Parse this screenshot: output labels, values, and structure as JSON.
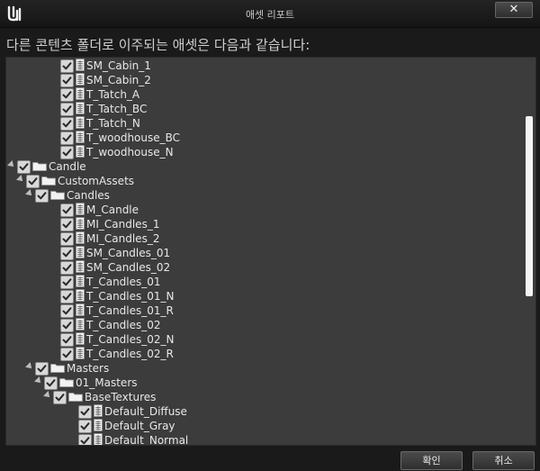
{
  "window": {
    "title": "애셋 리포트",
    "close_label": "✕"
  },
  "heading": "다른 콘텐츠 폴더로 이주되는 애셋은 다음과 같습니다:",
  "tree": [
    {
      "label": "SM_Cabin_1",
      "depth": 3,
      "kind": "file",
      "checked": true
    },
    {
      "label": "SM_Cabin_2",
      "depth": 3,
      "kind": "file",
      "checked": true
    },
    {
      "label": "T_Tatch_A",
      "depth": 3,
      "kind": "file",
      "checked": true
    },
    {
      "label": "T_Tatch_BC",
      "depth": 3,
      "kind": "file",
      "checked": true
    },
    {
      "label": "T_Tatch_N",
      "depth": 3,
      "kind": "file",
      "checked": true
    },
    {
      "label": "T_woodhouse_BC",
      "depth": 3,
      "kind": "file",
      "checked": true
    },
    {
      "label": "T_woodhouse_N",
      "depth": 3,
      "kind": "file",
      "checked": true
    },
    {
      "label": "Candle",
      "depth": 0,
      "kind": "folder",
      "checked": true
    },
    {
      "label": "CustomAssets",
      "depth": 1,
      "kind": "folder",
      "checked": true
    },
    {
      "label": "Candles",
      "depth": 2,
      "kind": "folder",
      "checked": true
    },
    {
      "label": "M_Candle",
      "depth": 3,
      "kind": "file",
      "checked": true
    },
    {
      "label": "MI_Candles_1",
      "depth": 3,
      "kind": "file",
      "checked": true
    },
    {
      "label": "MI_Candles_2",
      "depth": 3,
      "kind": "file",
      "checked": true
    },
    {
      "label": "SM_Candles_01",
      "depth": 3,
      "kind": "file",
      "checked": true
    },
    {
      "label": "SM_Candles_02",
      "depth": 3,
      "kind": "file",
      "checked": true
    },
    {
      "label": "T_Candles_01",
      "depth": 3,
      "kind": "file",
      "checked": true
    },
    {
      "label": "T_Candles_01_N",
      "depth": 3,
      "kind": "file",
      "checked": true
    },
    {
      "label": "T_Candles_01_R",
      "depth": 3,
      "kind": "file",
      "checked": true
    },
    {
      "label": "T_Candles_02",
      "depth": 3,
      "kind": "file",
      "checked": true
    },
    {
      "label": "T_Candles_02_N",
      "depth": 3,
      "kind": "file",
      "checked": true
    },
    {
      "label": "T_Candles_02_R",
      "depth": 3,
      "kind": "file",
      "checked": true
    },
    {
      "label": "Masters",
      "depth": 2,
      "kind": "folder",
      "checked": true
    },
    {
      "label": "01_Masters",
      "depth": 3,
      "kind": "folder",
      "checked": true
    },
    {
      "label": "BaseTextures",
      "depth": 4,
      "kind": "folder",
      "checked": true
    },
    {
      "label": "Default_Diffuse",
      "depth": 5,
      "kind": "file",
      "checked": true
    },
    {
      "label": "Default_Gray",
      "depth": 5,
      "kind": "file",
      "checked": true
    },
    {
      "label": "Default_Normal",
      "depth": 5,
      "kind": "file",
      "checked": true
    }
  ],
  "buttons": {
    "ok_label": "확인",
    "cancel_label": "취소"
  }
}
